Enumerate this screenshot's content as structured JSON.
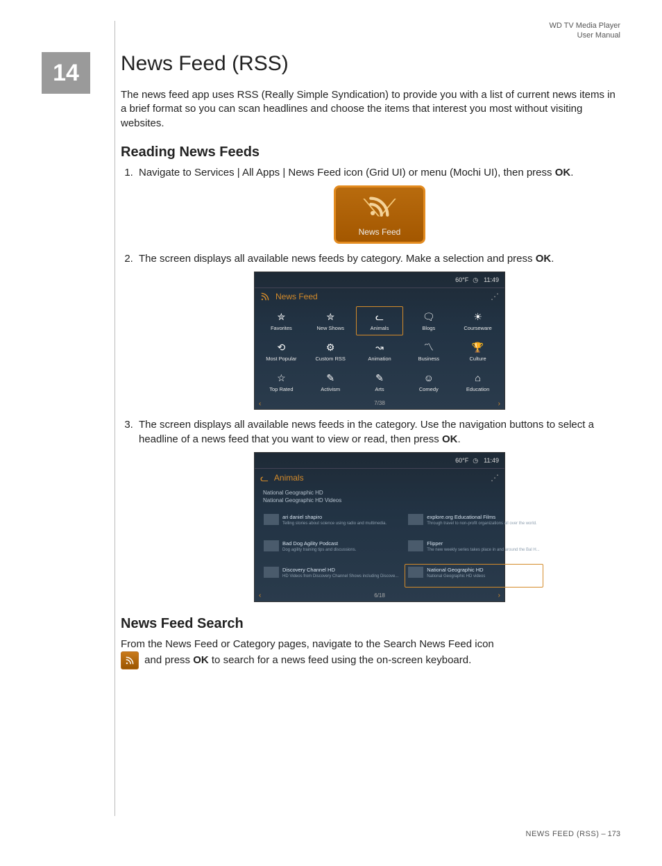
{
  "header": {
    "product": "WD TV Media Player",
    "doc": "User Manual"
  },
  "chapter_number": "14",
  "title": "News Feed (RSS)",
  "intro": "The news feed app uses RSS (Really Simple Syndication) to provide you with a list of current news items in a brief format so you can scan headlines and choose the items that interest you most without visiting websites.",
  "section1": {
    "heading": "Reading News Feeds",
    "step1_pre": "Navigate to Services | All Apps | News Feed icon (Grid UI) or menu (Mochi UI), then press ",
    "step1_bold": "OK",
    "step1_post": ".",
    "tile_label": "News Feed",
    "step2_pre": "The screen displays all available news feeds by category. Make a selection and press ",
    "step2_bold": "OK",
    "step2_post": ".",
    "step3_pre": "The screen displays all available news feeds in the category. Use the navigation buttons to select a headline of a news feed that you want to view or read, then press ",
    "step3_bold": "OK",
    "step3_post": "."
  },
  "shot1": {
    "temp": "60°F",
    "time": "11:49",
    "title": "News Feed",
    "pager": "7/38",
    "cells": [
      {
        "label": "Favorites",
        "icon": "✮"
      },
      {
        "label": "New Shows",
        "icon": "✮"
      },
      {
        "label": "Animals",
        "icon": "ᓚ",
        "selected": true
      },
      {
        "label": "Blogs",
        "icon": "🗨"
      },
      {
        "label": "Courseware",
        "icon": "☀"
      },
      {
        "label": "Most Popular",
        "icon": "⟲"
      },
      {
        "label": "Custom RSS",
        "icon": "⚙"
      },
      {
        "label": "Animation",
        "icon": "↝"
      },
      {
        "label": "Business",
        "icon": "〽"
      },
      {
        "label": "Culture",
        "icon": "🏆"
      },
      {
        "label": "Top Rated",
        "icon": "☆"
      },
      {
        "label": "Activism",
        "icon": "✎"
      },
      {
        "label": "Arts",
        "icon": "✎"
      },
      {
        "label": "Comedy",
        "icon": "☺"
      },
      {
        "label": "Education",
        "icon": "⌂"
      }
    ]
  },
  "shot2": {
    "temp": "60°F",
    "time": "11:49",
    "title": "Animals",
    "sub1": "National Geographic HD",
    "sub2": "National Geographic HD Videos",
    "pager": "6/18",
    "items": [
      {
        "title": "ari daniel shapiro",
        "sub": "Telling stories about science using radio and multimedia."
      },
      {
        "title": "explore.org Educational Films",
        "sub": "Through travel to non-profit organizations all over the world."
      },
      {
        "title": "Bad Dog Agility Podcast",
        "sub": "Dog agility training tips and discussions."
      },
      {
        "title": "Flipper",
        "sub": "The new weekly series takes place in and around the Bal H..."
      },
      {
        "title": "Discovery Channel HD",
        "sub": "HD Videos from Discovery Channel Shows including Discove..."
      },
      {
        "title": "National Geographic HD",
        "sub": "National Geographic HD videos",
        "selected": true
      }
    ]
  },
  "section2": {
    "heading": "News Feed Search",
    "line1": "From the News Feed or Category pages, navigate to the Search News Feed icon",
    "line2_pre": " and press ",
    "line2_bold": "OK",
    "line2_post": " to search for a news feed using the on-screen keyboard."
  },
  "footer": {
    "chapter": "NEWS FEED (RSS)",
    "sep": " – ",
    "page": "173"
  }
}
